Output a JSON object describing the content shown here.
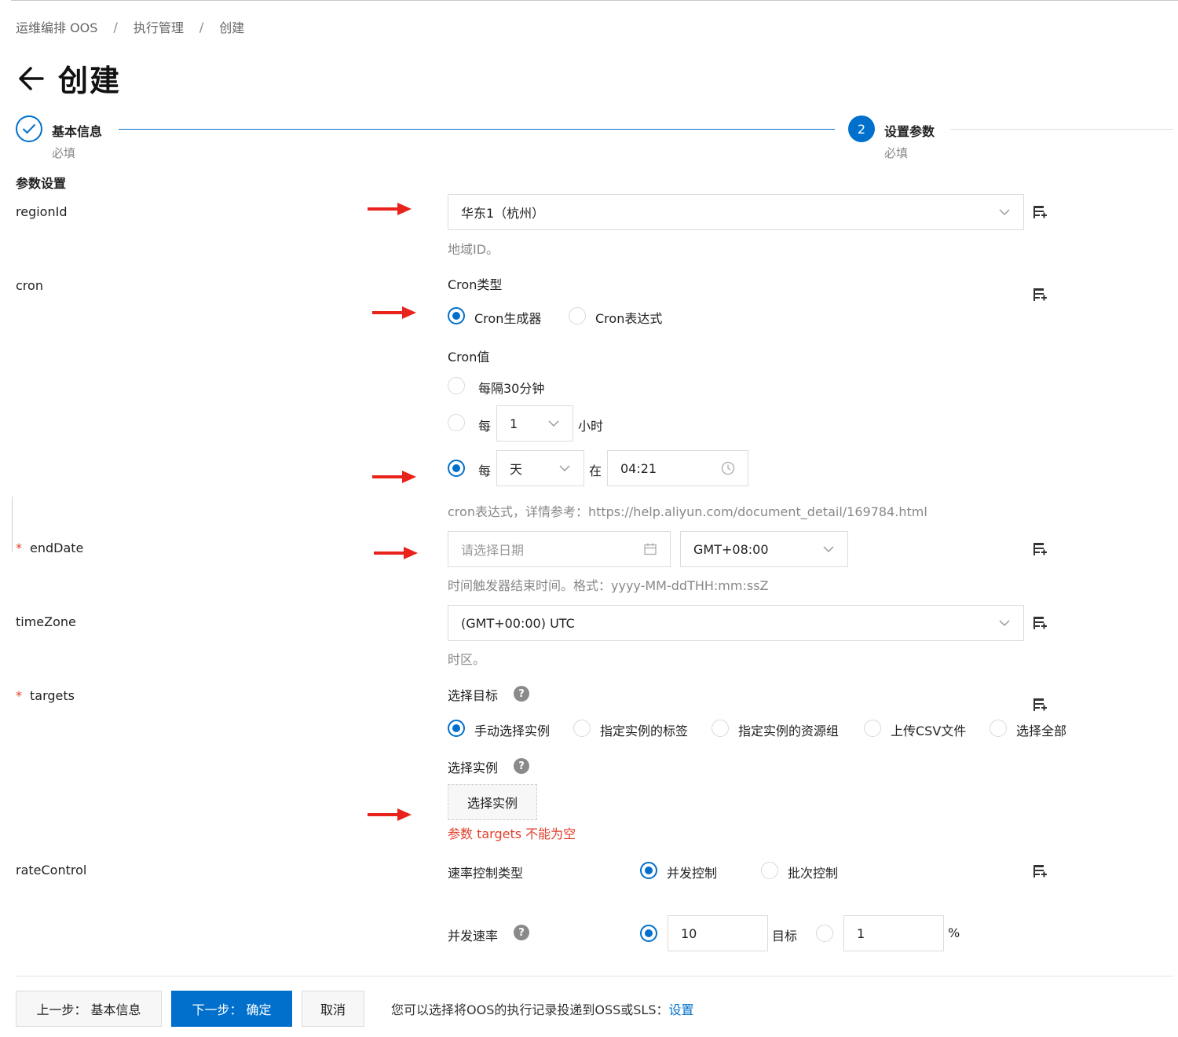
{
  "breadcrumb": [
    "运维编排 OOS",
    "执行管理",
    "创建"
  ],
  "title": "创建",
  "steps": [
    {
      "title": "基本信息",
      "sub": "必填",
      "index": "",
      "state": "done"
    },
    {
      "title": "设置参数",
      "sub": "必填",
      "index": "2",
      "state": "active"
    }
  ],
  "section_title": "参数设置",
  "fields": {
    "regionId": {
      "label": "regionId",
      "value": "华东1（杭州）",
      "help": "地域ID。"
    },
    "cron": {
      "label": "cron",
      "type_label": "Cron类型",
      "type_options": [
        "Cron生成器",
        "Cron表达式"
      ],
      "type_selected": "Cron生成器",
      "value_label": "Cron值",
      "opt_every30": "每隔30分钟",
      "opt_hourly_prefix": "每",
      "opt_hourly_value": "1",
      "opt_hourly_unit": "小时",
      "opt_daily_prefix": "每",
      "opt_daily_unit": "天",
      "opt_daily_at": "在",
      "opt_daily_time": "04:21",
      "help": "cron表达式，详情参考：https://help.aliyun.com/document_detail/169784.html"
    },
    "endDate": {
      "label": "endDate",
      "required": "*",
      "placeholder": "请选择日期",
      "timezone": "GMT+08:00",
      "help": "时间触发器结束时间。格式：yyyy-MM-ddTHH:mm:ssZ"
    },
    "timeZone": {
      "label": "timeZone",
      "value": "(GMT+00:00) UTC",
      "help": "时区。"
    },
    "targets": {
      "label": "targets",
      "required": "*",
      "select_target_label": "选择目标",
      "target_options": [
        "手动选择实例",
        "指定实例的标签",
        "指定实例的资源组",
        "上传CSV文件",
        "选择全部"
      ],
      "target_selected": "手动选择实例",
      "select_instance_label": "选择实例",
      "select_instance_button": "选择实例",
      "error": "参数 targets 不能为空"
    },
    "rateControl": {
      "label": "rateControl",
      "type_label": "速率控制类型",
      "type_options": [
        "并发控制",
        "批次控制"
      ],
      "type_selected": "并发控制",
      "rate_label": "并发速率",
      "rate_value": "10",
      "rate_unit": "目标",
      "percent_value": "1",
      "percent_unit": "%"
    }
  },
  "footer": {
    "prev_button": "上一步： 基本信息",
    "next_button": "下一步： 确定",
    "cancel_button": "取消",
    "note": "您可以选择将OOS的执行记录投递到OSS或SLS：",
    "note_link": "设置"
  },
  "colors": {
    "primary": "#0070cc",
    "error": "#e33e2b",
    "arrow": "#e8231b"
  }
}
